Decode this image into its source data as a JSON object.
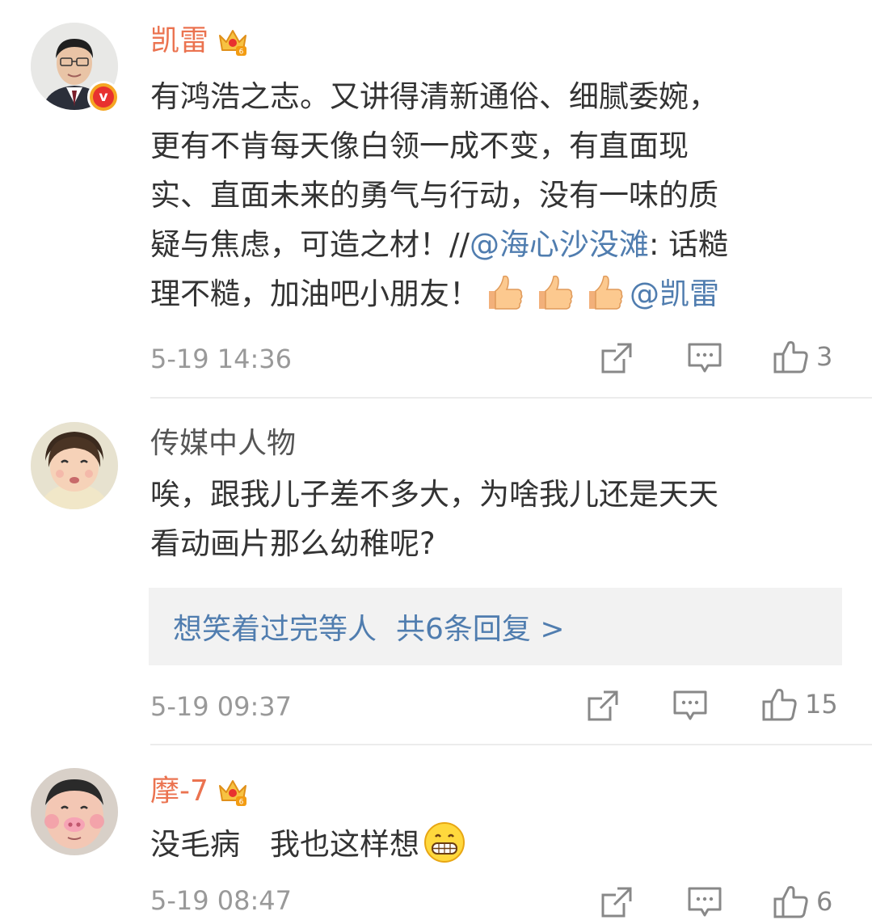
{
  "comments": [
    {
      "username": "凯雷",
      "lines": [
        "有鸿浩之志。又讲得清新通俗、细腻委婉，",
        "更有不肯每天像白领一成不变，有直面现",
        "实、直面未来的勇气与行动，没有一味的质"
      ],
      "line4_before": "疑与焦虑，可造之材！//",
      "line4_mention": "@海心沙没滩",
      "line4_after": ": 话糙",
      "line5_text": "理不糙，加油吧小朋友！",
      "line5_mention": "@凯雷",
      "time": "5-19 14:36",
      "likes": "3"
    },
    {
      "username": "传媒中人物",
      "lines": [
        "唉，跟我儿子差不多大，为啥我儿还是天天",
        "看动画片那么幼稚呢?"
      ],
      "reply_user": "想笑着过完等人",
      "reply_link": "共6条回复 >",
      "time": "5-19 09:37",
      "likes": "15"
    },
    {
      "username": "摩-7",
      "text": "没毛病　我也这样想",
      "time": "5-19 08:47",
      "likes": "6"
    }
  ],
  "icons": {
    "share": "share-icon",
    "comment": "comment-icon",
    "like": "thumbs-up-icon",
    "crown": "vip-crown-icon",
    "verified": "verified-v-badge"
  },
  "colors": {
    "vip_name": "#eb7350",
    "link": "#507daf",
    "text": "#333333",
    "meta": "#999999",
    "reply_bg": "#f2f2f2"
  }
}
